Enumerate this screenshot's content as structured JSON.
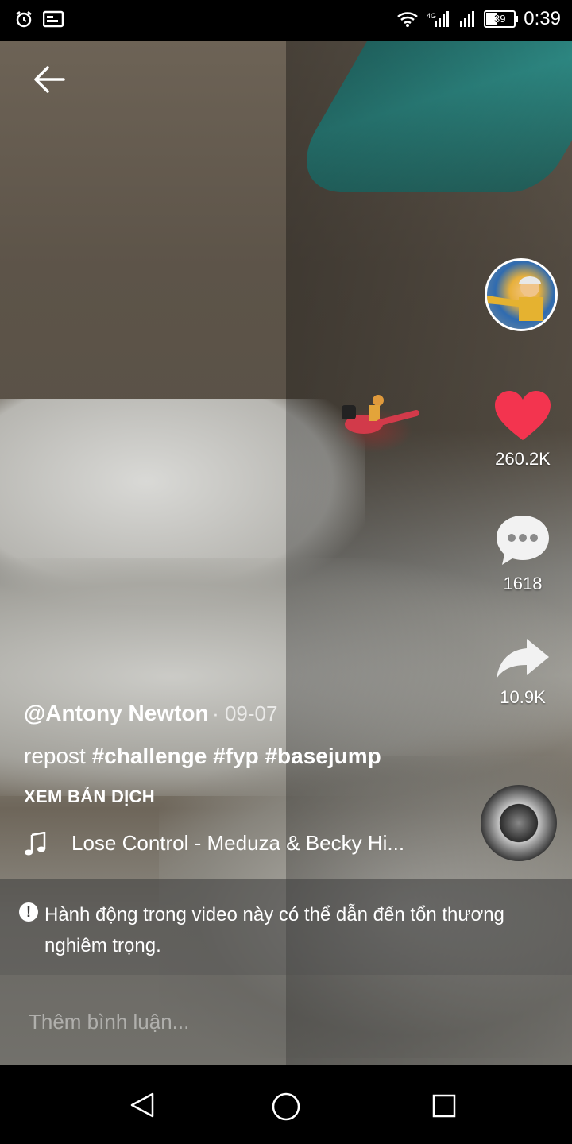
{
  "status_bar": {
    "time": "0:39",
    "battery": "39",
    "icons": [
      "alarm-icon",
      "screen-icon",
      "wifi-icon",
      "signal-4g-icon",
      "signal-icon"
    ]
  },
  "post": {
    "username": "@Antony Newton",
    "date": "· 09-07",
    "caption_prefix": "repost",
    "hashtags": [
      "#challenge",
      "#fyp",
      "#basejump"
    ],
    "translate_label": "XEM BẢN DỊCH",
    "music": "Lose Control - Meduza & Becky Hi..."
  },
  "actions": {
    "likes": "260.2K",
    "comments": "1618",
    "shares": "10.9K",
    "like_color": "#f3344f"
  },
  "warning": {
    "text": "Hành động trong video này có thể dẫn đến tổn thương nghiêm trọng."
  },
  "comment": {
    "placeholder": "Thêm bình luận..."
  }
}
